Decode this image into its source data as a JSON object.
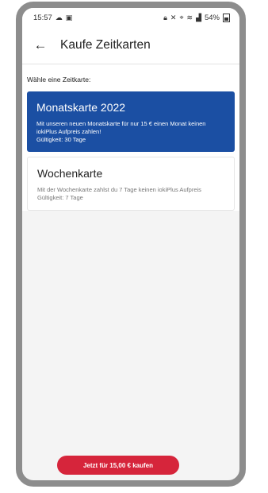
{
  "status": {
    "time": "15:57",
    "left_icons": [
      "cloud-icon",
      "image-icon"
    ],
    "right_icons": [
      "lock-icon",
      "mute-icon",
      "location-icon",
      "wifi-icon",
      "signal-icon"
    ],
    "battery_percent": "54%"
  },
  "header": {
    "title": "Kaufe Zeitkarten",
    "back_icon": "arrow-left-icon"
  },
  "main": {
    "section_label": "Wähle eine Zeitkarte:",
    "cards": [
      {
        "title": "Monatskarte 2022",
        "description": "Mit unseren neuen Monatskarte für nur 15 € einen Monat keinen iokiPlus Aufpreis zahlen!",
        "validity": "Gültigkeit: 30 Tage",
        "selected": true
      },
      {
        "title": "Wochenkarte",
        "description": "Mit der Wochenkarte zahlst du 7 Tage keinen iokiPlus Aufpreis",
        "validity": "Gültigkeit: 7 Tage",
        "selected": false
      }
    ]
  },
  "footer": {
    "buy_label": "Jetzt für 15,00 € kaufen"
  },
  "colors": {
    "accent": "#1b4fa3",
    "button": "#d6253b",
    "frame": "#8d8d8d"
  }
}
